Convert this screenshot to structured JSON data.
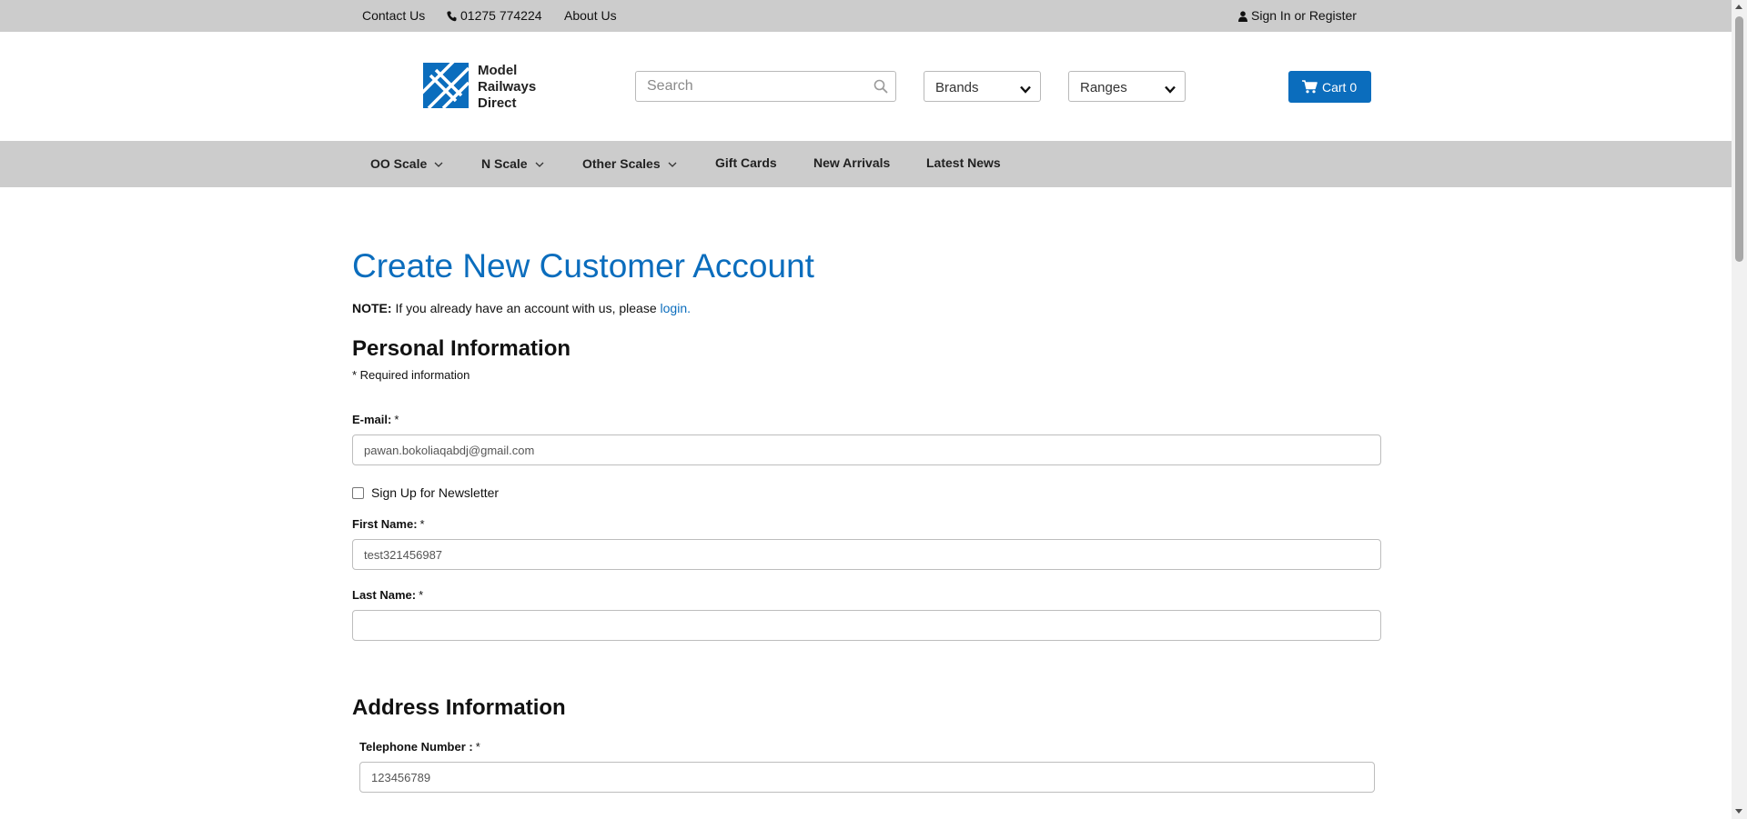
{
  "topbar": {
    "contact": "Contact Us",
    "phone": "01275 774224",
    "about": "About Us",
    "signin": "Sign In or Register"
  },
  "header": {
    "logo_lines": [
      "Model",
      "Railways",
      "Direct"
    ],
    "search_placeholder": "Search",
    "brands": "Brands",
    "ranges": "Ranges",
    "cart_label": "Cart",
    "cart_count": "0"
  },
  "nav": {
    "items": [
      {
        "label": "OO Scale",
        "dropdown": true
      },
      {
        "label": "N Scale",
        "dropdown": true
      },
      {
        "label": "Other Scales",
        "dropdown": true
      },
      {
        "label": "Gift Cards",
        "dropdown": false
      },
      {
        "label": "New Arrivals",
        "dropdown": false
      },
      {
        "label": "Latest News",
        "dropdown": false
      }
    ]
  },
  "page": {
    "title": "Create New Customer Account",
    "note_label": "NOTE:",
    "note_text": " If you already have an account with us, please ",
    "note_link": "login."
  },
  "personal": {
    "heading": "Personal Information",
    "required_info": "* Required information",
    "email_label": "E-mail:",
    "email_value": "pawan.bokoliaqabdj@gmail.com",
    "newsletter_label": "Sign Up for Newsletter",
    "newsletter_checked": false,
    "first_name_label": "First Name:",
    "first_name_value": "test321456987",
    "last_name_label": "Last Name:",
    "last_name_value": ""
  },
  "address": {
    "heading": "Address Information",
    "telephone_label": "Telephone Number :",
    "telephone_value": "123456789"
  },
  "required_marker": "*",
  "colors": {
    "accent": "#0b6dbd",
    "bar_gray": "#cccccc"
  }
}
